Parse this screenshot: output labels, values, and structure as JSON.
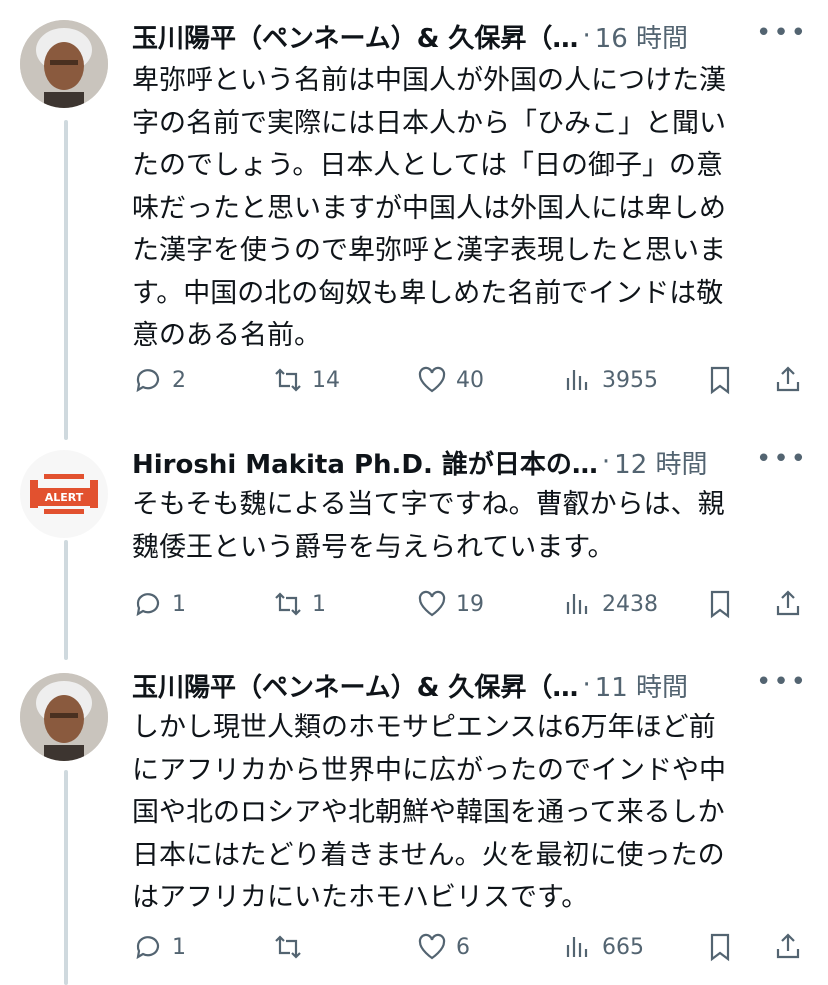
{
  "tweets": [
    {
      "name": "玉川陽平（ペンネーム）& 久保昇（…",
      "separator": "·",
      "time": "16 時間",
      "more": "•••",
      "text": "卑弥呼という名前は中国人が外国の人につけた漢\n字の名前で実際には日本人から「ひみこ」と聞い\nたのでしょう。日本人としては「日の御子」の意\n味だったと思いますが中国人は外国人には卑しめ\nた漢字を使うので卑弥呼と漢字表現したと思いま\nす。中国の北の匈奴も卑しめた名前でインドは敬\n意のある名前。",
      "replies": "2",
      "retweets": "14",
      "likes": "40",
      "views": "3955"
    },
    {
      "name": "Hiroshi Makita Ph.D. 誰が日本の…",
      "separator": "·",
      "time": "12 時間",
      "more": "•••",
      "avatar_text": "ALERT",
      "text": "そもそも魏による当て字ですね。曹叡からは、親\n魏倭王という爵号を与えられています。",
      "replies": "1",
      "retweets": "1",
      "likes": "19",
      "views": "2438"
    },
    {
      "name": "玉川陽平（ペンネーム）& 久保昇（…",
      "separator": "·",
      "time": "11 時間",
      "more": "•••",
      "text": "しかし現世人類のホモサピエンスは6万年ほど前\nにアフリカから世界中に広がったのでインドや中\n国や北のロシアや北朝鮮や韓国を通って来るしか\n日本にはたどり着きません。火を最初に使ったの\nはアフリカにいたホモハビリスです。",
      "replies": "1",
      "retweets": "",
      "likes": "6",
      "views": "665"
    }
  ],
  "colors": {
    "secondary": "#536471",
    "text": "#0f1419",
    "thread_line": "#cfd9de",
    "alert_red": "#e2512f"
  }
}
